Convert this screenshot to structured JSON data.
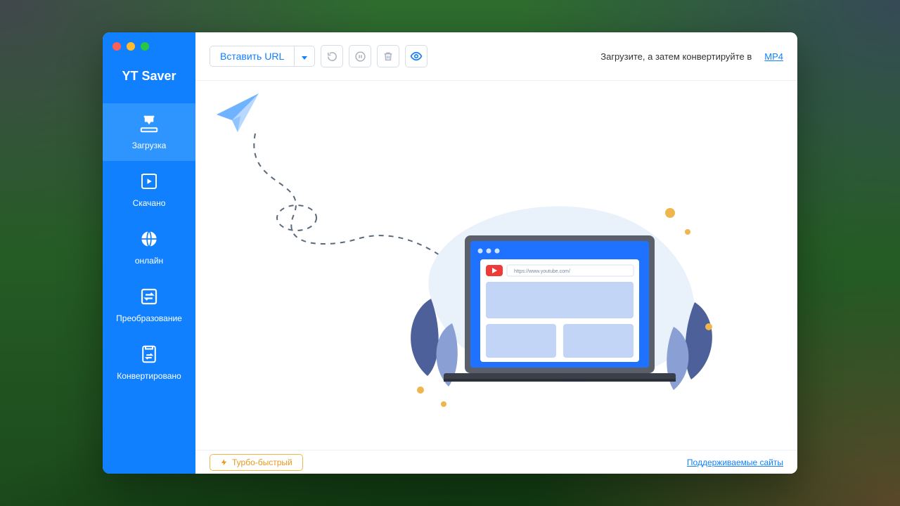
{
  "app": {
    "title": "YT Saver"
  },
  "sidebar": {
    "items": [
      {
        "label": "Загрузка"
      },
      {
        "label": "Скачано"
      },
      {
        "label": "онлайн"
      },
      {
        "label": "Преобразование"
      },
      {
        "label": "Конвертировано"
      }
    ]
  },
  "toolbar": {
    "paste_label": "Вставить URL",
    "convert_text": "Загрузите, а затем конвертируйте в",
    "format": "MP4"
  },
  "illustration": {
    "browser_url": "https://www.youtube.com/"
  },
  "footer": {
    "turbo_label": "Турбо-быстрый",
    "supported_label": "Поддерживаемые сайты"
  }
}
